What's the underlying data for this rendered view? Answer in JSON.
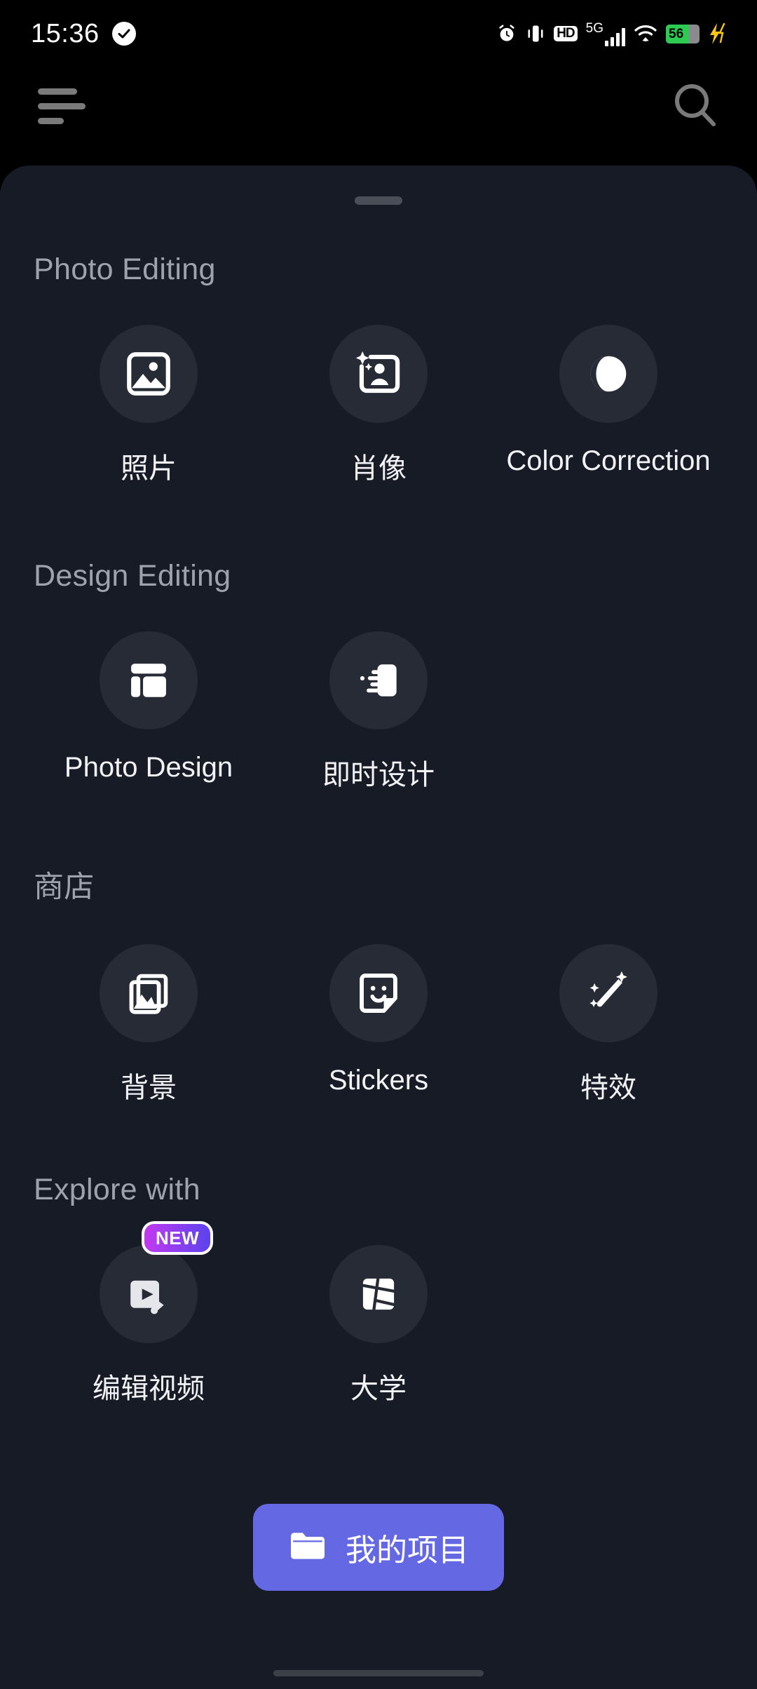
{
  "status_bar": {
    "time": "15:36",
    "check_icon": "check-circle-icon",
    "alarm_icon": "alarm-icon",
    "vibrate_icon": "vibrate-icon",
    "hd_label": "HD",
    "network_label": "5G",
    "wifi_icon": "wifi-icon",
    "battery_percent": "56",
    "charging_icon": "charging-bolt-icon"
  },
  "top_nav": {
    "menu_icon": "hamburger-menu-icon",
    "search_icon": "search-icon"
  },
  "sheet": {
    "grabber": "drag-handle"
  },
  "sections": [
    {
      "title": "Photo Editing",
      "items": [
        {
          "label": "照片",
          "icon": "image-landscape-icon",
          "badge": ""
        },
        {
          "label": "肖像",
          "icon": "portrait-sparkle-icon",
          "badge": ""
        },
        {
          "label": "Color Correction",
          "icon": "contrast-circle-icon",
          "badge": ""
        }
      ]
    },
    {
      "title": "Design Editing",
      "items": [
        {
          "label": "Photo Design",
          "icon": "layout-template-icon",
          "badge": ""
        },
        {
          "label": "即时设计",
          "icon": "instant-design-speed-icon",
          "badge": ""
        }
      ]
    },
    {
      "title": "商店",
      "items": [
        {
          "label": "背景",
          "icon": "stacked-photos-icon",
          "badge": ""
        },
        {
          "label": "Stickers",
          "icon": "sticker-smiley-icon",
          "badge": ""
        },
        {
          "label": "特效",
          "icon": "magic-wand-sparkle-icon",
          "badge": ""
        }
      ]
    },
    {
      "title": "Explore with",
      "items": [
        {
          "label": "编辑视频",
          "icon": "video-edit-icon",
          "badge": "NEW"
        },
        {
          "label": "大学",
          "icon": "collage-segments-icon",
          "badge": ""
        }
      ]
    }
  ],
  "bottom_button": {
    "label": "我的项目",
    "icon": "folder-icon",
    "color": "#6568e3"
  },
  "colors": {
    "sheet_background": "#171b25",
    "icon_circle": "#272b36",
    "section_title": "#9ea2ad",
    "item_label": "#f2f3f6",
    "accent": "#6568e3",
    "badge_gradient_start": "#c238ee",
    "badge_gradient_end": "#5a43ec",
    "battery_green": "#2ecb53"
  }
}
